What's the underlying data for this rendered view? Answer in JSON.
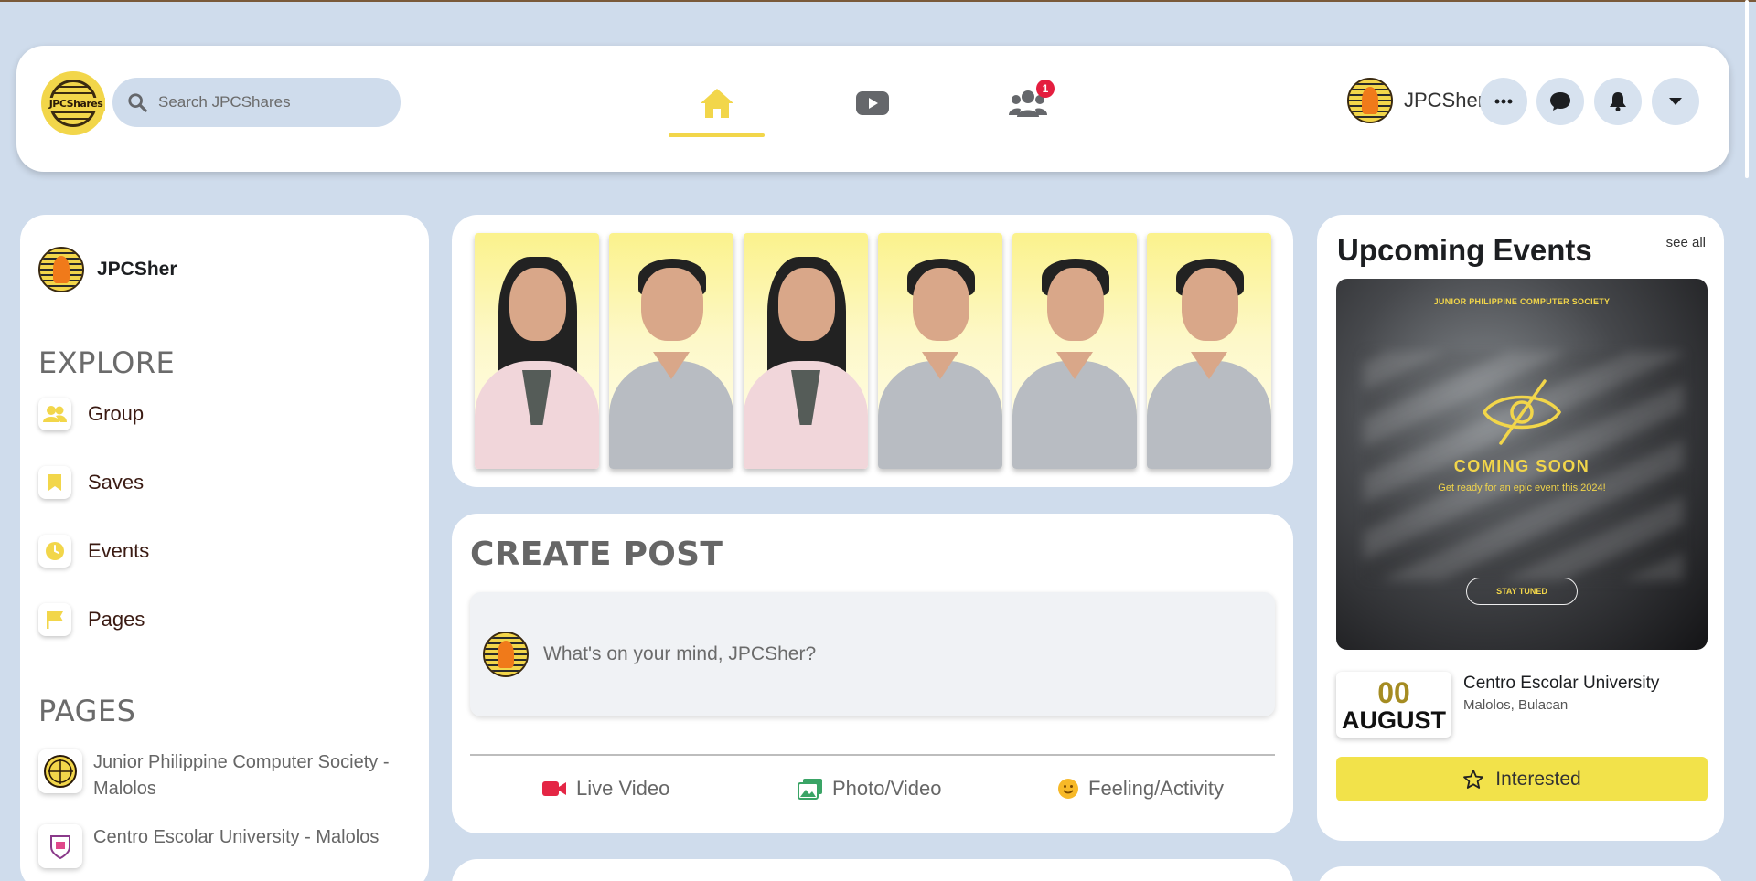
{
  "colors": {
    "accent": "#f2d64a",
    "page_bg": "#cfdcec",
    "badge_red": "#e41e3f"
  },
  "header": {
    "logo_text": "JPCShares",
    "search_placeholder": "Search JPCShares",
    "nav": [
      {
        "name": "home",
        "icon": "home-icon",
        "active": true
      },
      {
        "name": "video",
        "icon": "video-play-icon",
        "active": false
      },
      {
        "name": "friends",
        "icon": "friends-icon",
        "badge": "1",
        "active": false
      }
    ],
    "username": "JPCSher",
    "action_icons": [
      "more-icon",
      "messenger-icon",
      "bell-icon",
      "caret-down-icon"
    ]
  },
  "sidebar": {
    "username": "JPCSher",
    "explore_title": "EXPLORE",
    "explore_items": [
      {
        "label": "Group",
        "icon": "group-icon"
      },
      {
        "label": "Saves",
        "icon": "bookmark-icon"
      },
      {
        "label": "Events",
        "icon": "clock-icon"
      },
      {
        "label": "Pages",
        "icon": "flag-icon"
      }
    ],
    "pages_title": "PAGES",
    "pages": [
      {
        "label": "Junior Philippine Computer Society - Malolos",
        "icon": "jpcs-logo-icon"
      },
      {
        "label": "Centro Escolar University - Malolos",
        "icon": "ceu-logo-icon"
      }
    ]
  },
  "stories": {
    "count": 6
  },
  "create_post": {
    "title": "CREATE POST",
    "placeholder": "What's on your mind, JPCSher?",
    "actions": [
      {
        "label": "Live Video",
        "icon": "live-video-icon",
        "color": "#e42645"
      },
      {
        "label": "Photo/Video",
        "icon": "photo-icon",
        "color": "#3aa466"
      },
      {
        "label": "Feeling/Activity",
        "icon": "smiley-icon",
        "color": "#f7b928"
      }
    ]
  },
  "events": {
    "title": "Upcoming Events",
    "see_all": "see all",
    "banner": {
      "org": "JUNIOR PHILIPPINE COMPUTER SOCIETY",
      "headline": "COMING SOON",
      "tagline": "Get ready for an epic event this 2024!",
      "button": "STAY TUNED"
    },
    "date_day": "00",
    "date_month": "AUGUST",
    "venue": "Centro Escolar University",
    "location": "Malolos, Bulacan",
    "interested_label": "Interested"
  }
}
